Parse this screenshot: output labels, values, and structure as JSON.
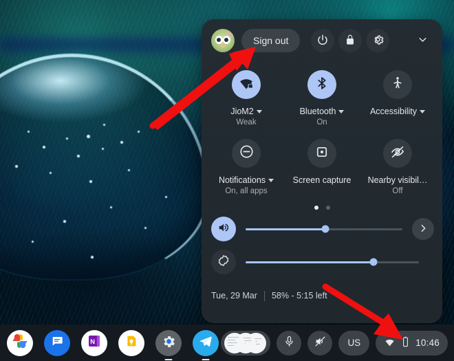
{
  "wallpaper": {
    "description": "macro photo of a water droplet on a dark teal-blue feather"
  },
  "quick_settings": {
    "header": {
      "avatar_name": "user-avatar",
      "sign_out_label": "Sign out",
      "power_icon": "power-icon",
      "lock_icon": "lock-icon",
      "settings_icon": "gear-icon",
      "collapse_icon": "chevron-down-icon"
    },
    "tiles": [
      {
        "id": "network",
        "icon": "wifi-locked-icon",
        "label": "JioM2",
        "sublabel": "Weak",
        "state": "on",
        "has_caret": true,
        "two_line_label": false
      },
      {
        "id": "bluetooth",
        "icon": "bluetooth-icon",
        "label": "Bluetooth",
        "sublabel": "On",
        "state": "on",
        "has_caret": true,
        "two_line_label": false
      },
      {
        "id": "accessibility",
        "icon": "accessibility-icon",
        "label": "Accessibility",
        "sublabel": "",
        "state": "off",
        "has_caret": true,
        "two_line_label": false
      },
      {
        "id": "notifications",
        "icon": "do-not-disturb-icon",
        "label": "Notifications",
        "sublabel": "On, all apps",
        "state": "off",
        "has_caret": true,
        "two_line_label": false
      },
      {
        "id": "screen_capture",
        "icon": "screen-capture-icon",
        "label": "Screen capture",
        "sublabel": "",
        "state": "off",
        "has_caret": false,
        "two_line_label": true
      },
      {
        "id": "nearby",
        "icon": "eye-off-icon",
        "label": "Nearby visibil…",
        "sublabel": "Off",
        "state": "off",
        "has_caret": false,
        "two_line_label": false
      }
    ],
    "pages": {
      "count": 2,
      "active_index": 0
    },
    "sliders": [
      {
        "id": "volume",
        "icon": "volume-up-icon",
        "value": 51,
        "icon_state": "on",
        "has_next_button": true,
        "next_icon": "chevron-right-icon"
      },
      {
        "id": "brightness",
        "icon": "brightness-icon",
        "value": 74,
        "icon_state": "off",
        "has_next_button": false,
        "next_icon": ""
      }
    ],
    "footer": {
      "date": "Tue, 29 Mar",
      "battery": "58% - 5:15 left"
    }
  },
  "shelf": {
    "apps": [
      {
        "id": "photos",
        "name": "google-photos-icon",
        "open": false
      },
      {
        "id": "messages",
        "name": "messages-icon",
        "open": false
      },
      {
        "id": "onenote",
        "name": "onenote-icon",
        "open": false
      },
      {
        "id": "keep",
        "name": "google-keep-icon",
        "open": false
      },
      {
        "id": "settings",
        "name": "settings-icon",
        "open": true
      },
      {
        "id": "telegram",
        "name": "telegram-icon",
        "open": true
      }
    ],
    "status": {
      "window_preview": "window-previews",
      "mic_icon": "microphone-icon",
      "audio_icon": "audio-muted-icon",
      "keyboard_label": "US",
      "tray": {
        "wifi_icon": "wifi-icon",
        "battery_icon": "battery-icon",
        "time": "10:46"
      }
    }
  },
  "annotations": {
    "arrow_color": "#f01010",
    "arrows": [
      {
        "id": "arrow-to-sign-out",
        "points_to": "Sign out"
      },
      {
        "id": "arrow-to-system-tray",
        "points_to": "status tray"
      }
    ]
  }
}
